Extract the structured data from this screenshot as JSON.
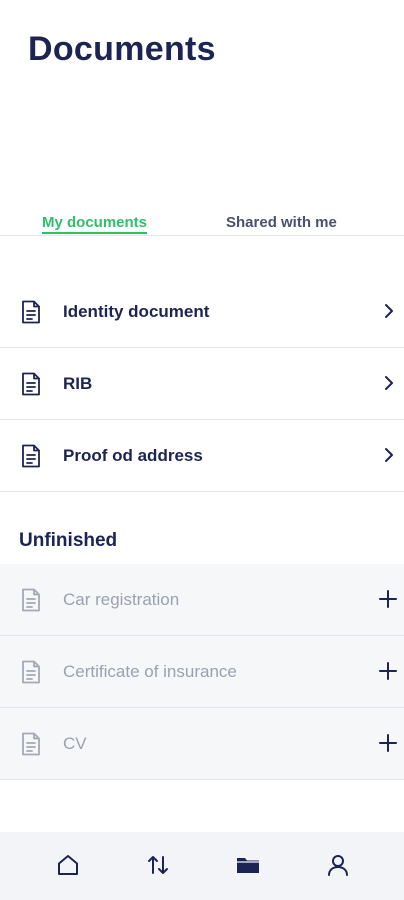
{
  "header": {
    "title": "Documents"
  },
  "tabs": [
    {
      "label": "My documents",
      "active": true
    },
    {
      "label": "Shared with me",
      "active": false
    }
  ],
  "documents": [
    {
      "label": "Identity document",
      "icon": "document-icon"
    },
    {
      "label": "RIB",
      "icon": "document-icon"
    },
    {
      "label": "Proof od address",
      "icon": "document-icon"
    }
  ],
  "unfinished": {
    "title": "Unfinished",
    "items": [
      {
        "label": "Car registration",
        "icon": "document-icon"
      },
      {
        "label": "Certificate of insurance",
        "icon": "document-icon"
      },
      {
        "label": "CV",
        "icon": "document-icon"
      }
    ]
  },
  "bottom_nav": [
    {
      "icon": "home-icon",
      "active": false
    },
    {
      "icon": "transfer-icon",
      "active": false
    },
    {
      "icon": "folder-icon",
      "active": true
    },
    {
      "icon": "profile-icon",
      "active": false
    }
  ],
  "colors": {
    "primary": "#1c2453",
    "accent": "#2fbf6a",
    "muted": "#9aa1b3",
    "divider": "#e3e6ee"
  }
}
